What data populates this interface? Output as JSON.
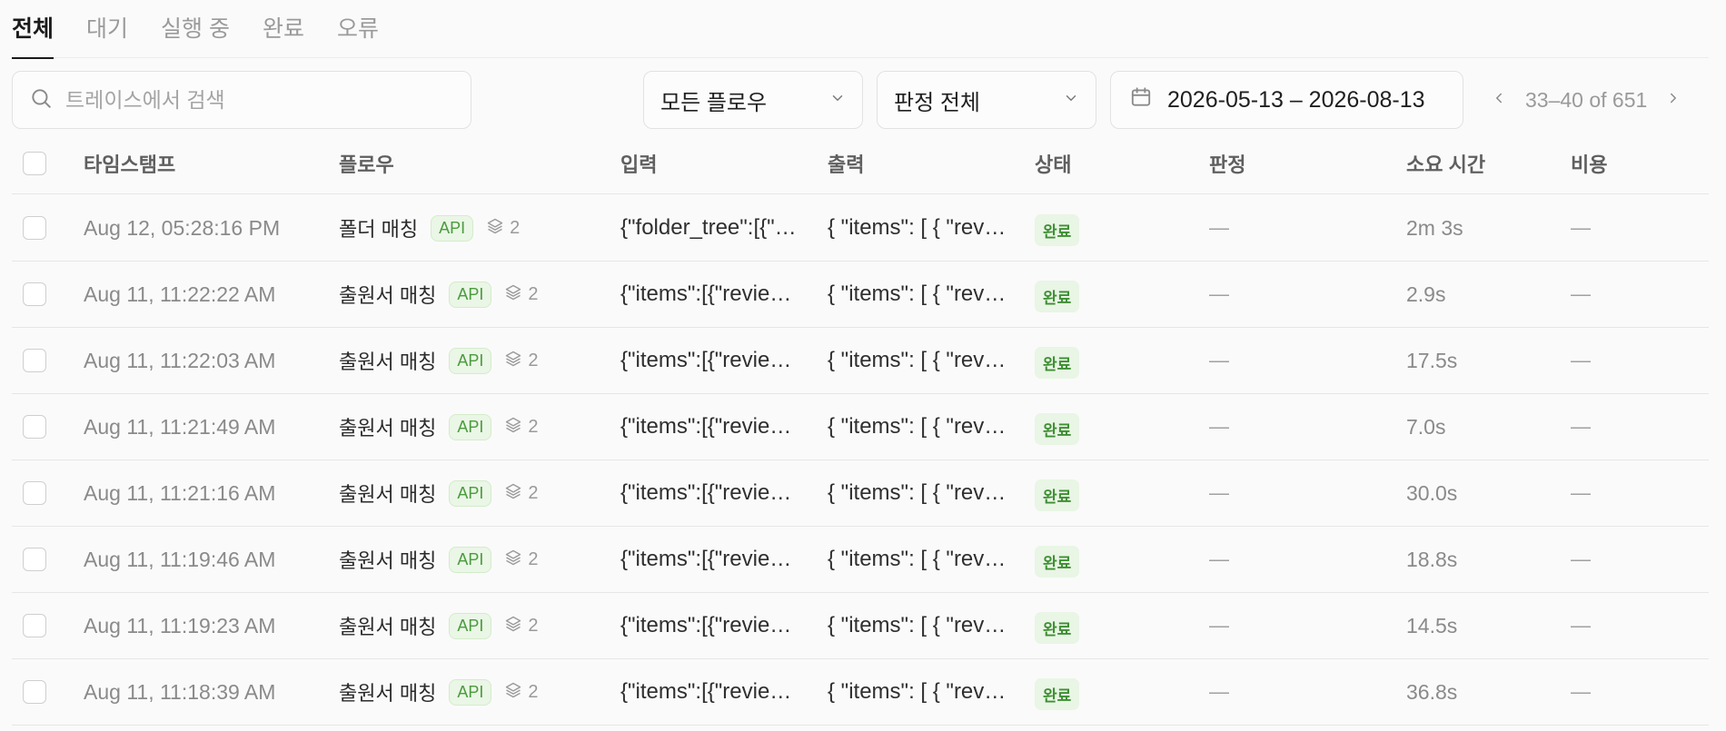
{
  "tabs": [
    {
      "label": "전체",
      "active": true
    },
    {
      "label": "대기",
      "active": false
    },
    {
      "label": "실행 중",
      "active": false
    },
    {
      "label": "완료",
      "active": false
    },
    {
      "label": "오류",
      "active": false
    }
  ],
  "search": {
    "placeholder": "트레이스에서 검색",
    "value": ""
  },
  "filters": {
    "flow": "모든 플로우",
    "verdict": "판정 전체",
    "date_range": "2026-05-13 – 2026-08-13"
  },
  "pagination": {
    "info": "33–40 of 651"
  },
  "table": {
    "headers": {
      "timestamp": "타임스탬프",
      "flow": "플로우",
      "input": "입력",
      "output": "출력",
      "status": "상태",
      "verdict": "판정",
      "duration": "소요 시간",
      "cost": "비용"
    },
    "rows": [
      {
        "timestamp": "Aug 12, 05:28:16 PM",
        "flow": "폴더 매칭",
        "badge": "API",
        "steps": "2",
        "input": "{\"folder_tree\":[{\"",
        "output": "{ \"items\": [ { \"rev",
        "status": "완료",
        "verdict": "—",
        "duration": "2m 3s",
        "cost": "—"
      },
      {
        "timestamp": "Aug 11, 11:22:22 AM",
        "flow": "출원서 매칭",
        "badge": "API",
        "steps": "2",
        "input": "{\"items\":[{\"revie",
        "output": "{ \"items\": [ { \"rev",
        "status": "완료",
        "verdict": "—",
        "duration": "2.9s",
        "cost": "—"
      },
      {
        "timestamp": "Aug 11, 11:22:03 AM",
        "flow": "출원서 매칭",
        "badge": "API",
        "steps": "2",
        "input": "{\"items\":[{\"revie",
        "output": "{ \"items\": [ { \"rev",
        "status": "완료",
        "verdict": "—",
        "duration": "17.5s",
        "cost": "—"
      },
      {
        "timestamp": "Aug 11, 11:21:49 AM",
        "flow": "출원서 매칭",
        "badge": "API",
        "steps": "2",
        "input": "{\"items\":[{\"revie",
        "output": "{ \"items\": [ { \"rev",
        "status": "완료",
        "verdict": "—",
        "duration": "7.0s",
        "cost": "—"
      },
      {
        "timestamp": "Aug 11, 11:21:16 AM",
        "flow": "출원서 매칭",
        "badge": "API",
        "steps": "2",
        "input": "{\"items\":[{\"revie",
        "output": "{ \"items\": [ { \"rev",
        "status": "완료",
        "verdict": "—",
        "duration": "30.0s",
        "cost": "—"
      },
      {
        "timestamp": "Aug 11, 11:19:46 AM",
        "flow": "출원서 매칭",
        "badge": "API",
        "steps": "2",
        "input": "{\"items\":[{\"revie",
        "output": "{ \"items\": [ { \"rev",
        "status": "완료",
        "verdict": "—",
        "duration": "18.8s",
        "cost": "—"
      },
      {
        "timestamp": "Aug 11, 11:19:23 AM",
        "flow": "출원서 매칭",
        "badge": "API",
        "steps": "2",
        "input": "{\"items\":[{\"revie",
        "output": "{ \"items\": [ { \"rev",
        "status": "완료",
        "verdict": "—",
        "duration": "14.5s",
        "cost": "—"
      },
      {
        "timestamp": "Aug 11, 11:18:39 AM",
        "flow": "출원서 매칭",
        "badge": "API",
        "steps": "2",
        "input": "{\"items\":[{\"revie",
        "output": "{ \"items\": [ { \"rev",
        "status": "완료",
        "verdict": "—",
        "duration": "36.8s",
        "cost": "—"
      }
    ]
  },
  "icons": {
    "search": "search-icon",
    "dropdown": "chevron-down-icon",
    "calendar": "calendar-icon",
    "prev": "chevron-left-icon",
    "next": "chevron-right-icon",
    "steps": "layers-icon"
  },
  "colors": {
    "api_badge_text": "#4b9b3e",
    "api_badge_bg": "#eaf6e6",
    "status_done_text": "#3e8f33",
    "status_done_bg": "#e9f5e5",
    "active_tab": "#1a1a1a"
  }
}
